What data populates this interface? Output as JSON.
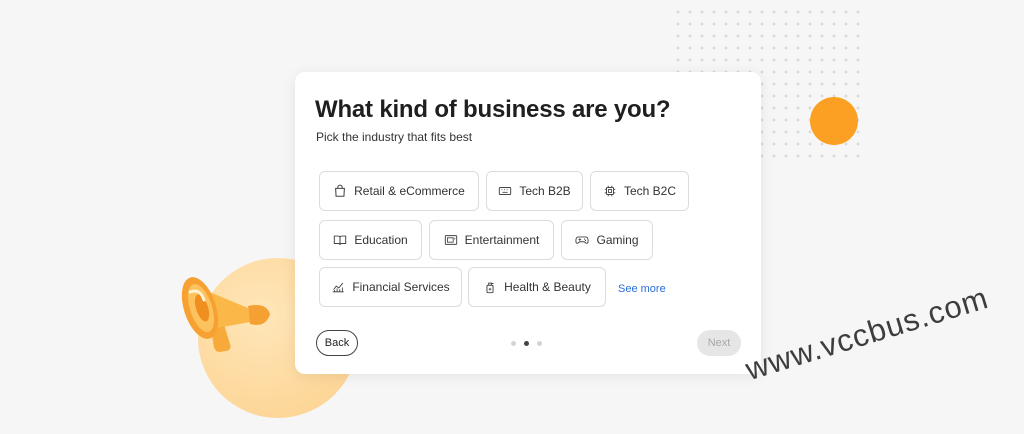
{
  "card": {
    "title": "What kind of business are you?",
    "subtitle": "Pick the industry that fits best"
  },
  "industries": [
    {
      "label": "Retail & eCommerce",
      "icon": "shopping-bag-icon"
    },
    {
      "label": "Tech B2B",
      "icon": "keyboard-icon"
    },
    {
      "label": "Tech B2C",
      "icon": "chip-icon"
    },
    {
      "label": "Education",
      "icon": "book-icon"
    },
    {
      "label": "Entertainment",
      "icon": "tv-icon"
    },
    {
      "label": "Gaming",
      "icon": "gamepad-icon"
    },
    {
      "label": "Financial Services",
      "icon": "chart-icon"
    },
    {
      "label": "Health & Beauty",
      "icon": "lotion-bottle-icon"
    }
  ],
  "see_more": "See more",
  "nav": {
    "back": "Back",
    "next": "Next",
    "pager": {
      "total": 3,
      "current": 2
    }
  },
  "watermark": "www.vccbus.com",
  "colors": {
    "accent_orange": "#fba022",
    "link_blue": "#2a6fdb",
    "disabled_gray": "#e6e6e6"
  }
}
